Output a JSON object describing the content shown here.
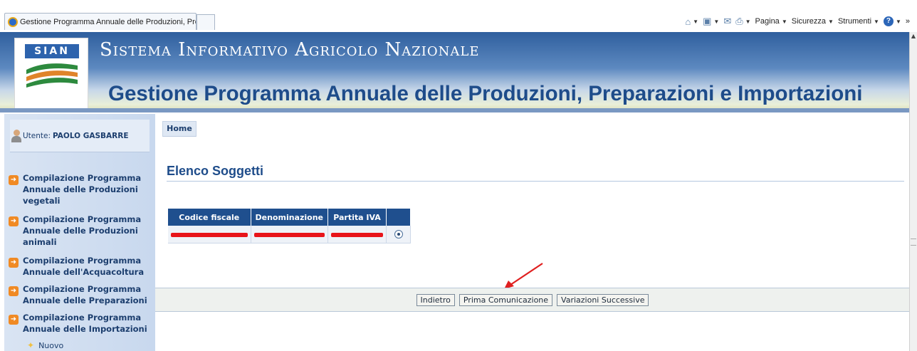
{
  "browser": {
    "tab_title": "Gestione Programma Annuale delle Produzioni, Prepar...",
    "commands": {
      "pagina": "Pagina",
      "sicurezza": "Sicurezza",
      "strumenti": "Strumenti",
      "more": "»"
    }
  },
  "banner": {
    "logo_text": "SIAN",
    "system_name": "Sistema Informativo Agricolo Nazionale",
    "app_title": "Gestione Programma Annuale delle Produzioni, Preparazioni e Importazioni"
  },
  "sidebar": {
    "user_label": "Utente:",
    "user_name": "PAOLO GASBARRE",
    "items": [
      {
        "label": "Compilazione Programma Annuale delle Produzioni vegetali"
      },
      {
        "label": "Compilazione Programma Annuale delle Produzioni animali"
      },
      {
        "label": "Compilazione Programma Annuale dell'Acquacoltura"
      },
      {
        "label": "Compilazione Programma Annuale delle Preparazioni"
      },
      {
        "label": "Compilazione Programma Annuale delle Importazioni"
      }
    ],
    "subitem": "Nuovo"
  },
  "main": {
    "breadcrumb_home": "Home",
    "title": "Elenco Soggetti",
    "table": {
      "headers": [
        "Codice fiscale",
        "Denominazione",
        "Partita IVA",
        ""
      ],
      "row_selected": true
    },
    "buttons": {
      "back": "Indietro",
      "first": "Prima Comunicazione",
      "variations": "Variazioni Successive"
    }
  },
  "colors": {
    "banner_blue": "#2f5f9e",
    "title_blue": "#1e4c8a",
    "header_blue": "#1f4f8e",
    "redaction_red": "#e8141a",
    "menu_arrow": "#f08a24"
  },
  "icons": [
    "ie-icon",
    "home-icon",
    "feeds-icon",
    "mail-icon",
    "print-icon",
    "help-icon",
    "user-icon",
    "arrow-right-icon",
    "star-icon",
    "annotation-arrow-icon"
  ]
}
